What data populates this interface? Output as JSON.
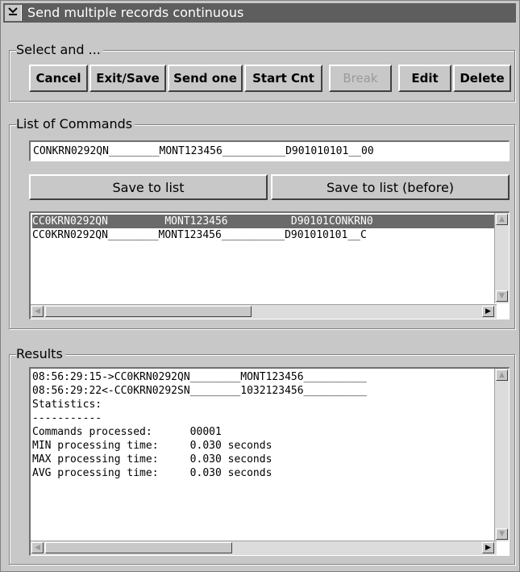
{
  "window": {
    "title": "Send multiple records continuous",
    "sysmenu_icon": "chevron-down-icon"
  },
  "select_group": {
    "label": "Select and ...",
    "buttons": {
      "cancel": "Cancel",
      "exit_save": "Exit/Save",
      "send_one": "Send one",
      "start_cnt": "Start Cnt",
      "break": "Break",
      "edit": "Edit",
      "delete": "Delete"
    }
  },
  "commands_group": {
    "label": "List of Commands",
    "command_input": "CONKRN0292QN________MONT123456__________D901010101__00",
    "save_to_list": "Save to list",
    "save_to_list_before": "Save to list (before)",
    "list": [
      {
        "text": "CC0KRN0292QN         MONT123456          D90101CONKRN0",
        "selected": true
      },
      {
        "text": "CC0KRN0292QN________MONT123456__________D901010101__C",
        "selected": false
      }
    ]
  },
  "results_group": {
    "label": "Results",
    "lines": [
      "08:56:29:15->CC0KRN0292QN________MONT123456__________",
      "08:56:29:22<-CC0KRN0292SN________1032123456__________",
      "Statistics:",
      "-----------",
      "Commands processed:      00001",
      "MIN processing time:     0.030 seconds",
      "MAX processing time:     0.030 seconds",
      "AVG processing time:     0.030 seconds"
    ]
  }
}
